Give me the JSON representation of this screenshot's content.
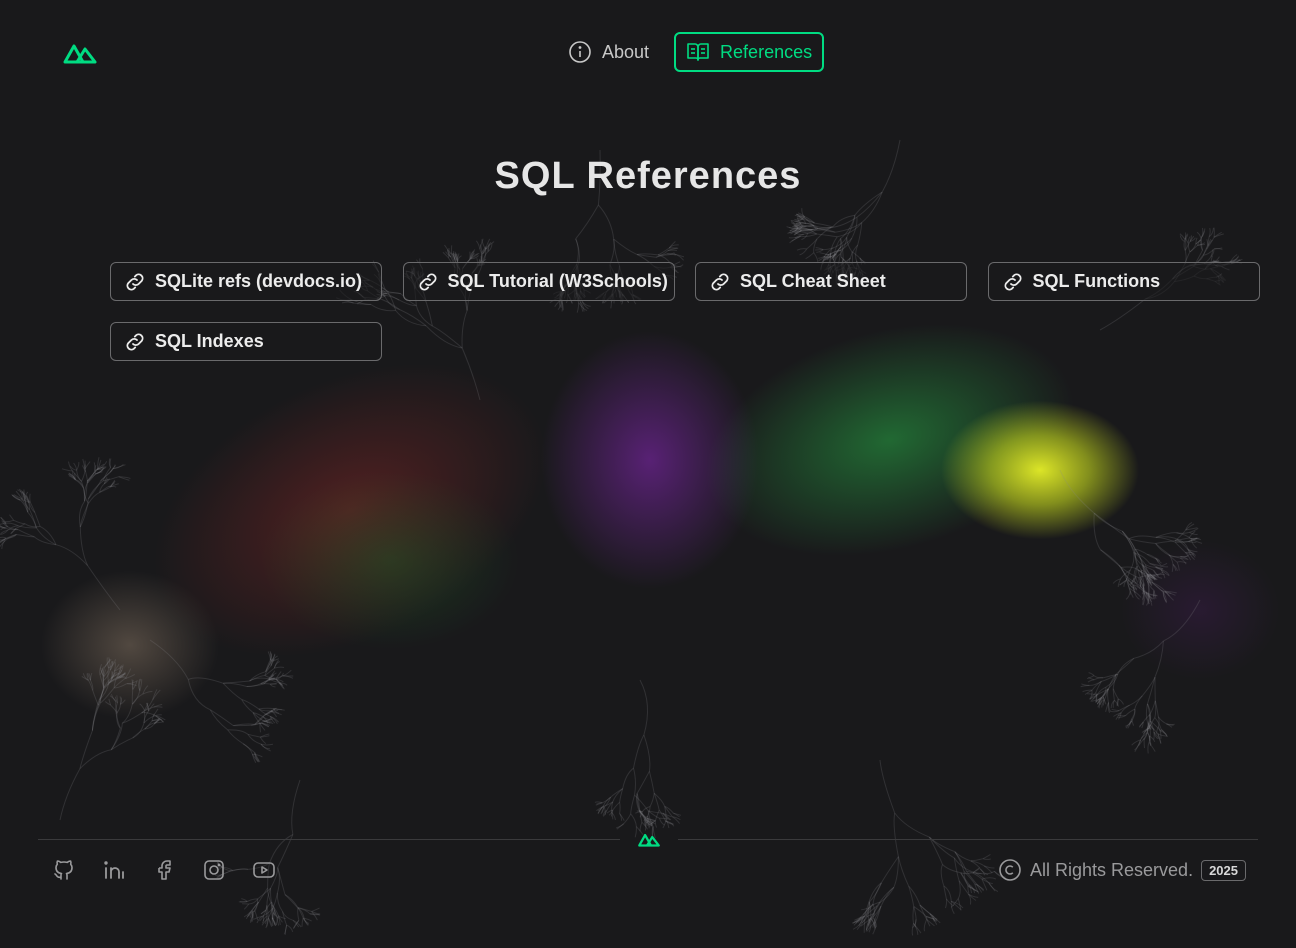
{
  "colors": {
    "accent": "#00dc82",
    "background": "#19191b",
    "text": "#e5e5e5"
  },
  "header": {
    "logo": "nuxt-logo-icon",
    "nav": [
      {
        "label": "About",
        "icon": "info-circle-icon",
        "active": false
      },
      {
        "label": "References",
        "icon": "open-book-icon",
        "active": true
      }
    ]
  },
  "main": {
    "title": "SQL References",
    "links": [
      {
        "label": "SQLite refs (devdocs.io)",
        "icon": "link-icon"
      },
      {
        "label": "SQL Tutorial (W3Schools)",
        "icon": "link-icon"
      },
      {
        "label": "SQL Cheat Sheet",
        "icon": "link-icon"
      },
      {
        "label": "SQL Functions",
        "icon": "link-icon"
      },
      {
        "label": "SQL Indexes",
        "icon": "link-icon"
      }
    ]
  },
  "footer": {
    "socials": [
      "github-icon",
      "linkedin-icon",
      "facebook-icon",
      "instagram-icon",
      "youtube-icon"
    ],
    "rights_text": "All Rights Reserved.",
    "year": "2025",
    "copyright_icon": "copyright-icon"
  }
}
